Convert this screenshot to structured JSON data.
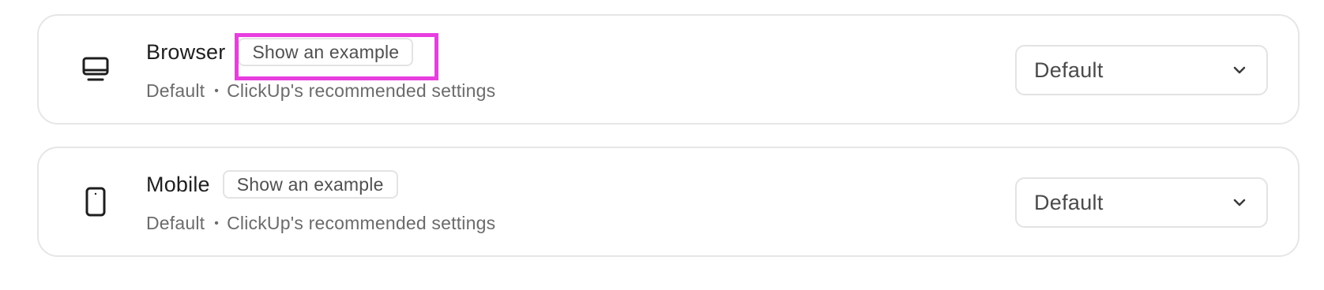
{
  "rows": [
    {
      "icon": "monitor-icon",
      "title": "Browser",
      "example_label": "Show an example",
      "status": "Default",
      "description": "ClickUp's recommended settings",
      "dropdown_value": "Default"
    },
    {
      "icon": "mobile-phone-icon",
      "title": "Mobile",
      "example_label": "Show an example",
      "status": "Default",
      "description": "ClickUp's recommended settings",
      "dropdown_value": "Default"
    }
  ],
  "highlight_color": "#e83ee0"
}
